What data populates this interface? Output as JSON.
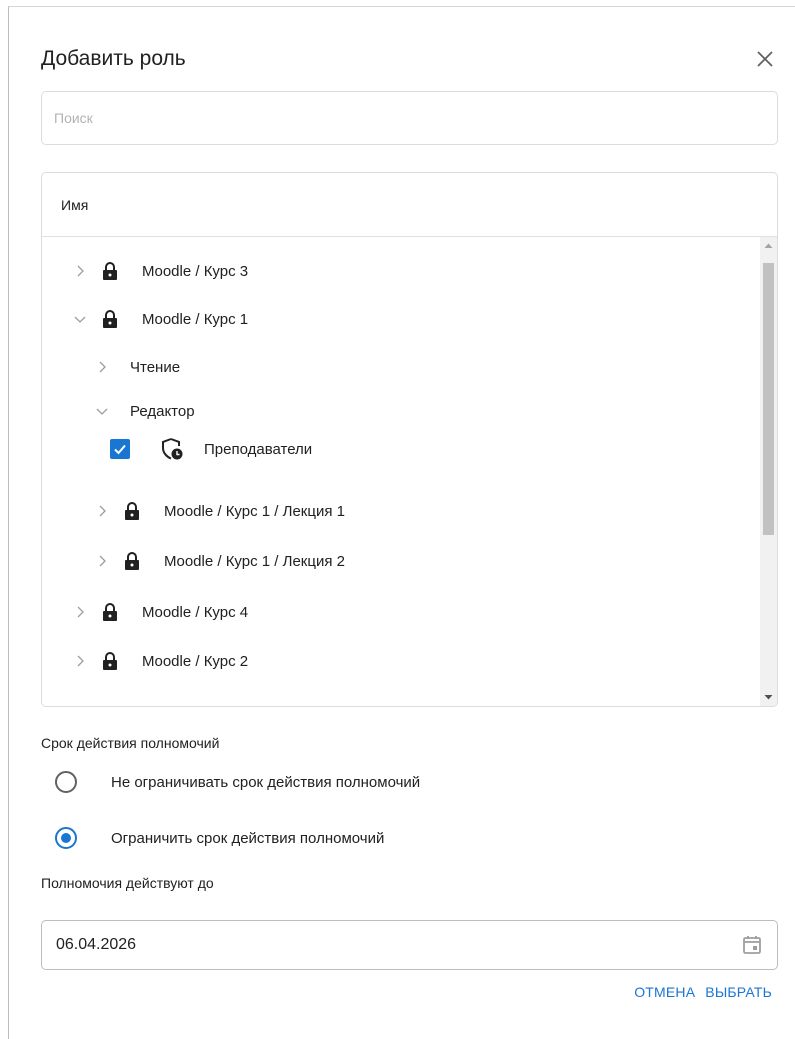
{
  "dialog": {
    "title": "Добавить роль"
  },
  "search": {
    "placeholder": "Поиск",
    "value": ""
  },
  "tree": {
    "header": "Имя",
    "rows": [
      {
        "label": "Moodle / Курс 3",
        "expanded": false,
        "icon": "lock-icon"
      },
      {
        "label": "Moodle / Курс 1",
        "expanded": true,
        "icon": "lock-icon"
      },
      {
        "label": "Чтение",
        "expanded": false
      },
      {
        "label": "Редактор",
        "expanded": true
      },
      {
        "label": "Преподаватели",
        "checked": true,
        "icon": "shield-clock-icon"
      },
      {
        "label": "Moodle / Курс 1 / Лекция 1",
        "expanded": false,
        "icon": "lock-icon"
      },
      {
        "label": "Moodle / Курс 1 / Лекция 2",
        "expanded": false,
        "icon": "lock-icon"
      },
      {
        "label": "Moodle / Курс 4",
        "expanded": false,
        "icon": "lock-icon"
      },
      {
        "label": "Moodle / Курс 2",
        "expanded": false,
        "icon": "lock-icon"
      }
    ]
  },
  "validity": {
    "label": "Срок действия полномочий",
    "options": [
      {
        "label": "Не ограничивать срок действия полномочий",
        "checked": false
      },
      {
        "label": "Ограничить срок действия полномочий",
        "checked": true
      }
    ],
    "until_label": "Полномочия действуют до",
    "date_value": "06.04.2026"
  },
  "actions": {
    "cancel_label": "ОТМЕНА",
    "select_label": "ВЫБРАТЬ"
  },
  "colors": {
    "accent": "#1976d2"
  }
}
